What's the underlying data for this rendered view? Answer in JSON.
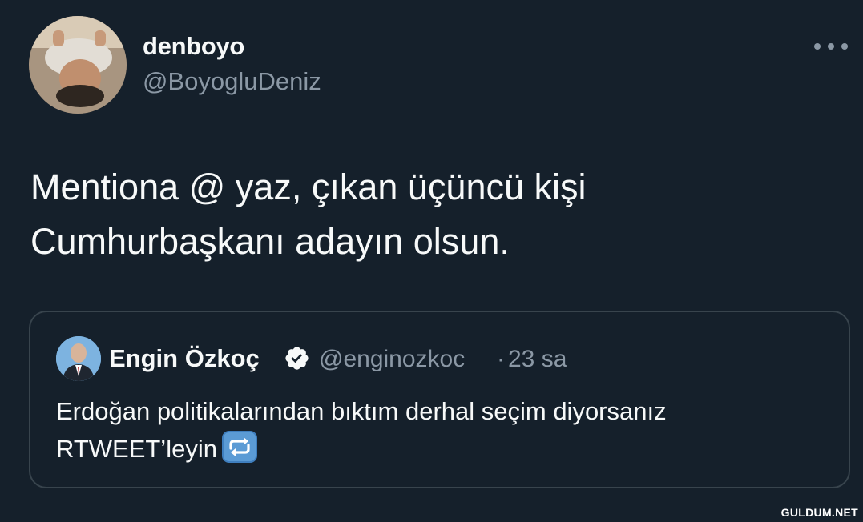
{
  "author": {
    "name": "denboyo",
    "handle": "@BoyogluDeniz"
  },
  "tweet": {
    "text_line1": "Mentiona @ yaz, çıkan üçüncü kişi",
    "text_line2": "Cumhurbaşkanı adayın olsun."
  },
  "quoted_tweet": {
    "name": "Engin Özkoç",
    "handle": "@enginozkoc",
    "separator": "·",
    "time": "23 sa",
    "text_line1": "Erdoğan politikalarından bıktım derhal seçim diyorsanız",
    "text_line2": "RTWEET’leyin",
    "emoji": "repeat-button-emoji"
  },
  "icons": {
    "more": "more-horizontal-icon",
    "verified": "verified-badge-icon"
  },
  "colors": {
    "background": "#15202b",
    "primary_text": "#f7f9f9",
    "secondary_text": "#8b98a5",
    "border": "#38444d"
  },
  "watermark": "GULDUM.NET"
}
